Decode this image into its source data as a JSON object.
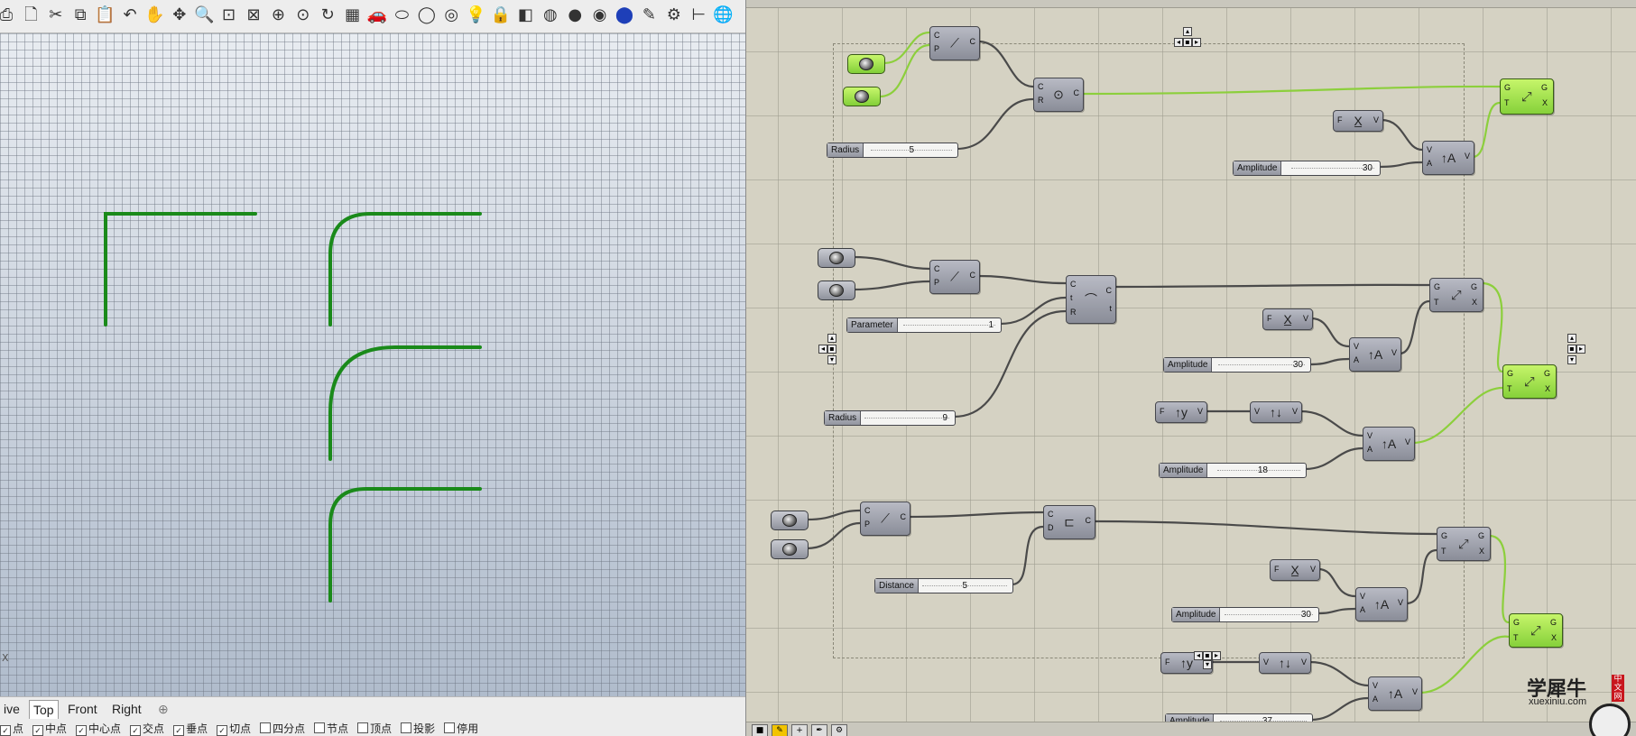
{
  "rhino": {
    "toolbar_icons": [
      "print-icon",
      "new-doc-icon",
      "cut-icon",
      "copy-icon",
      "paste-icon",
      "undo-icon",
      "pan-hand-icon",
      "rotate-view-icon",
      "zoom-icon",
      "zoom-window-icon",
      "zoom-extents-icon",
      "zoom-target-icon",
      "zoom-selected-icon",
      "rotate-icon",
      "grid-layout-icon",
      "car-icon",
      "ellipse-icon",
      "circle-icon",
      "camera-icon",
      "light-bulb-icon",
      "lock-icon",
      "layer-icon",
      "color-wheel-icon",
      "sphere-grey-icon",
      "sphere-dark-icon",
      "sphere-blue-icon",
      "pen-icon",
      "gears-icon",
      "dimension-icon",
      "globe-icon"
    ],
    "viewport": {
      "curve_color": "#1a8a1a",
      "axis_label": "X"
    },
    "viewport_tabs": [
      "ive",
      "Top",
      "Front",
      "Right"
    ],
    "add_tab_symbol": "⊕",
    "osnap": {
      "items": [
        {
          "label": "点",
          "checked": true
        },
        {
          "label": "中点",
          "checked": true
        },
        {
          "label": "中心点",
          "checked": true
        },
        {
          "label": "交点",
          "checked": true
        },
        {
          "label": "垂点",
          "checked": true
        },
        {
          "label": "切点",
          "checked": true
        },
        {
          "label": "四分点",
          "checked": false
        },
        {
          "label": "节点",
          "checked": false
        },
        {
          "label": "顶点",
          "checked": false
        },
        {
          "label": "投影",
          "checked": false
        },
        {
          "label": "停用",
          "checked": false
        }
      ]
    }
  },
  "grasshopper": {
    "wire_color": "#4a4a4a",
    "active_wire_color": "#8ccf3c",
    "sliders": {
      "radius1": {
        "label": "Radius",
        "value": "5"
      },
      "amplitude1": {
        "label": "Amplitude",
        "value": "30"
      },
      "parameter": {
        "label": "Parameter",
        "value": "1"
      },
      "amplitude2": {
        "label": "Amplitude",
        "value": "30"
      },
      "radius2": {
        "label": "Radius",
        "value": "9"
      },
      "amplitude3": {
        "label": "Amplitude",
        "value": "18"
      },
      "distance": {
        "label": "Distance",
        "value": "5"
      },
      "amplitude4": {
        "label": "Amplitude",
        "value": "30"
      },
      "amplitude5": {
        "label": "Amplitude",
        "value": "37"
      }
    },
    "watermark": {
      "main": "学犀牛",
      "sub": "xuexiniu.com",
      "badge": "中文网"
    }
  }
}
